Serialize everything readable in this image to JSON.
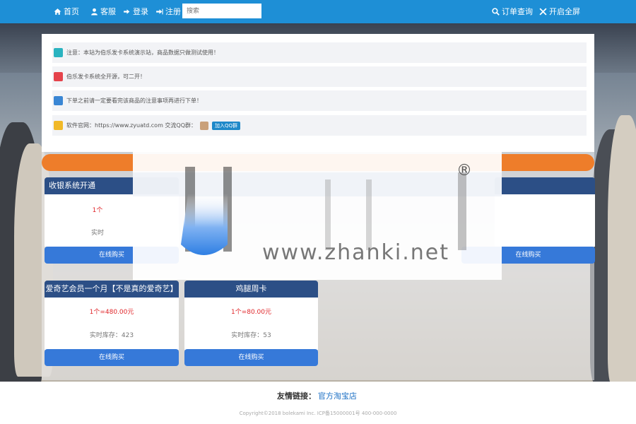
{
  "nav": {
    "home": "首页",
    "service": "客服",
    "login": "登录",
    "register": "注册",
    "search_placeholder": "搜索",
    "order_query": "订单查询",
    "fullscreen": "开启全屏"
  },
  "notices": [
    {
      "text": "注意：本站为伯乐发卡系统演示站，商品数据只做测试使用！",
      "icon_color": "#2ab3c0"
    },
    {
      "text": "伯乐发卡系统全开源，可二开！",
      "icon_color": "#e5434b"
    },
    {
      "text": "下单之前请一定要看完该商品的注意事项再进行下单！",
      "icon_color": "#3a86d4"
    },
    {
      "text": "软件官网：https://www.zyuatd.com 交流QQ群：",
      "icon_color": "#f1b928",
      "qq_button": "加入QQ群"
    }
  ],
  "cards": [
    {
      "title": "收银系统开通",
      "price": "1个",
      "stock": "实时",
      "button": "在线购买"
    },
    {
      "title": "",
      "price": "",
      "stock": "",
      "button": "在线购买"
    },
    {
      "title": "爱奇艺会员一个月【不是真的爱奇艺】",
      "price": "1个=480.00元",
      "stock": "实时库存：423",
      "button": "在线购买"
    },
    {
      "title": "鸡腿周卡",
      "price": "1个=80.00元",
      "stock": "实时库存：53",
      "button": "在线购买"
    }
  ],
  "watermark": {
    "text": "www.zhanki.net",
    "mark": "®"
  },
  "footer": {
    "links_label": "友情链接：",
    "link": "官方淘宝店",
    "copyright": "Copyright©2018 bolekami Inc.  ICP备15000001号  400-000-0000"
  },
  "colors": {
    "nav": "#1e8fd6",
    "card_head": "#2c4f86",
    "button": "#3679d9",
    "accent_bar": "#ee7d2a",
    "price": "#e0262a"
  }
}
